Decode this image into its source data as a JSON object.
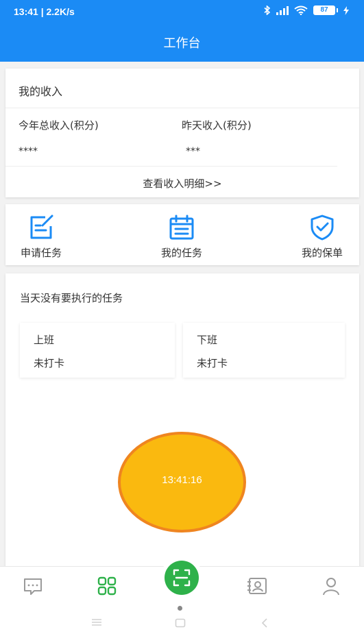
{
  "status_bar": {
    "time": "13:41 | 2.2K/s",
    "battery": "87",
    "icons": [
      "bluetooth-icon",
      "signal-icon",
      "wifi-icon",
      "battery-icon",
      "charging-icon"
    ]
  },
  "header": {
    "title": "工作台"
  },
  "income": {
    "title": "我的收入",
    "year_label": "今年总收入(积分)",
    "year_value": "****",
    "yesterday_label": "昨天收入(积分)",
    "yesterday_value": "***",
    "detail_link": "查看收入明细>>"
  },
  "actions": [
    {
      "label": "申请任务",
      "icon": "apply-task-icon"
    },
    {
      "label": "我的任务",
      "icon": "calendar-task-icon"
    },
    {
      "label": "我的保单",
      "icon": "shield-check-icon"
    }
  ],
  "tasks": {
    "empty_text": "当天没有要执行的任务",
    "clock_in": {
      "label": "上班",
      "status": "未打卡"
    },
    "clock_out": {
      "label": "下班",
      "status": "未打卡"
    },
    "punch_time": "13:41:16"
  },
  "tabbar": {
    "items": [
      "message-icon",
      "workbench-icon",
      "scan-icon",
      "contacts-icon",
      "profile-icon"
    ],
    "active": "workbench-icon"
  },
  "colors": {
    "primary_blue": "#1b8bf5",
    "active_green": "#2eb14a",
    "punch_fill": "#fab90f",
    "punch_ring": "#ef8520"
  }
}
